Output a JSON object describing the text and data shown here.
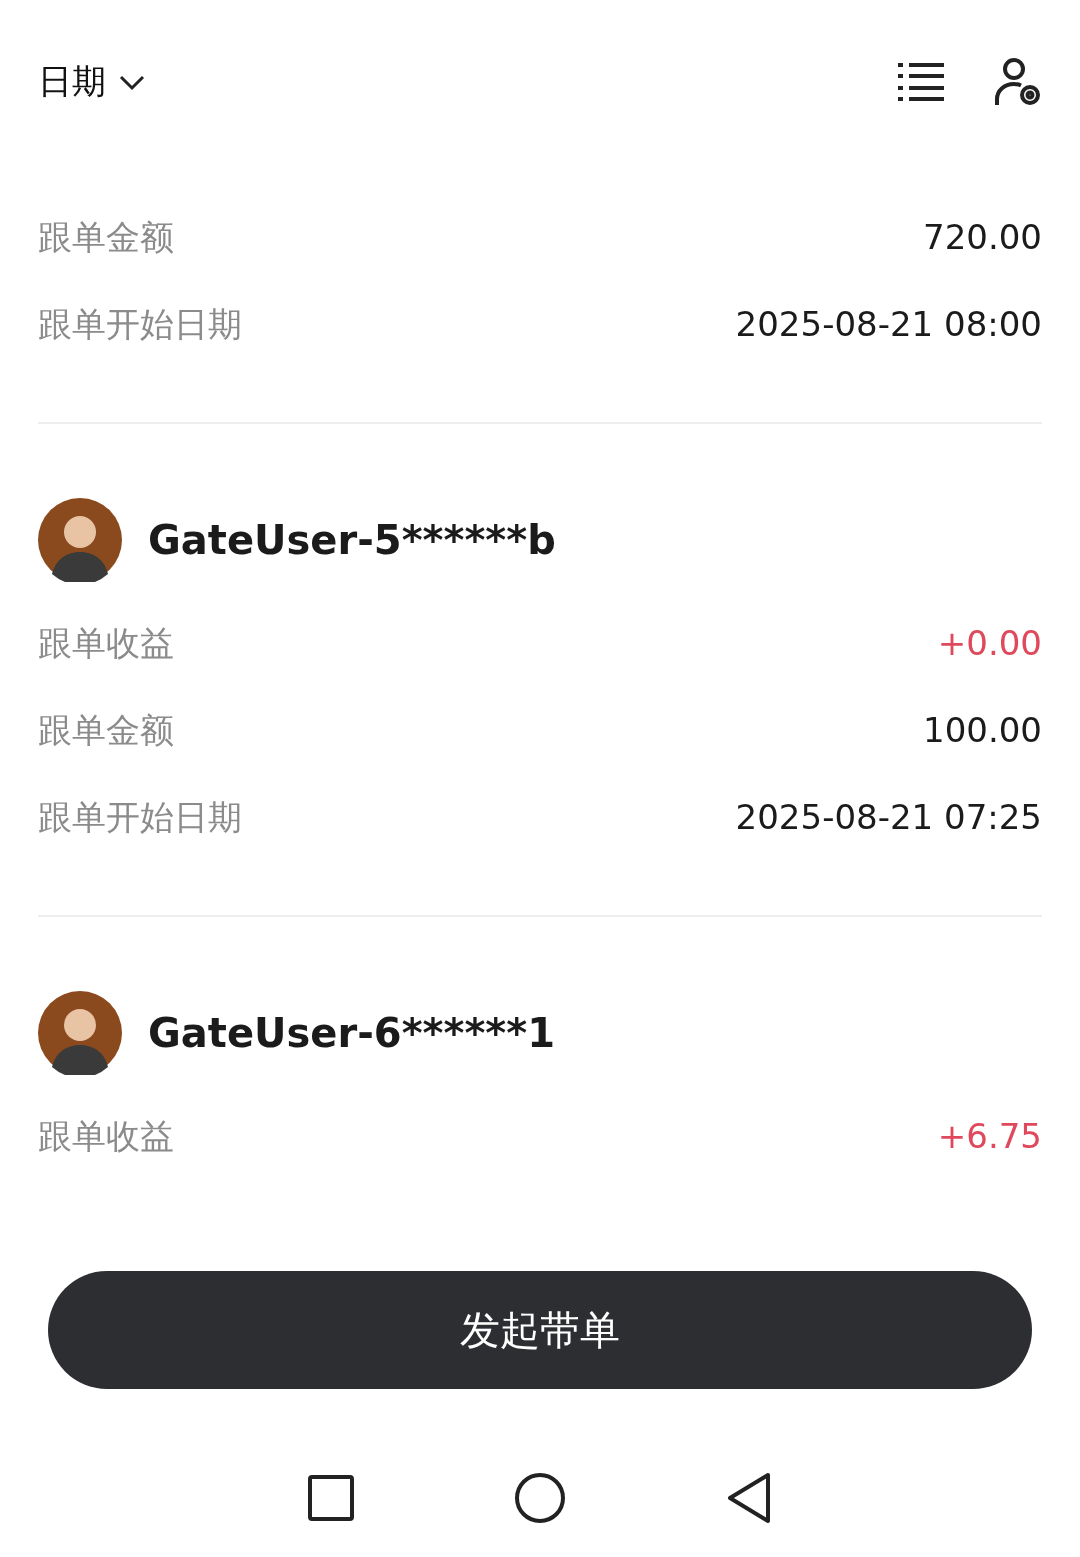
{
  "header": {
    "title": "日期"
  },
  "sections": [
    {
      "rows": [
        {
          "label": "跟单金额",
          "value": "720.00",
          "kind": "plain"
        },
        {
          "label": "跟单开始日期",
          "value": "2025-08-21 08:00",
          "kind": "plain"
        }
      ]
    },
    {
      "user": "GateUser-5******b",
      "rows": [
        {
          "label": "跟单收益",
          "value": "+0.00",
          "kind": "profit"
        },
        {
          "label": "跟单金额",
          "value": "100.00",
          "kind": "plain"
        },
        {
          "label": "跟单开始日期",
          "value": "2025-08-21 07:25",
          "kind": "plain"
        }
      ]
    },
    {
      "user": "GateUser-6******1",
      "rows": [
        {
          "label": "跟单收益",
          "value": "+6.75",
          "kind": "profit"
        }
      ]
    }
  ],
  "button": "发起带单"
}
